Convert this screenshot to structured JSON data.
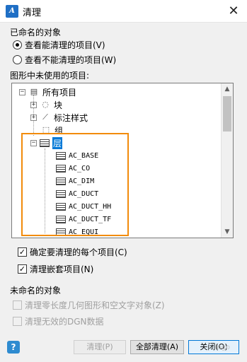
{
  "window": {
    "title": "清理",
    "close_glyph": "✕",
    "app_icon_glyph": "A"
  },
  "named_objects": {
    "group_label": "已命名的对象",
    "radio_purgeable": "查看能清理的项目(V)",
    "radio_non_purgeable": "查看不能清理的项目(W)",
    "tree_label": "图形中未使用的项目:"
  },
  "tree": {
    "root": "所有项目",
    "nodes": [
      "块",
      "标注样式",
      "组"
    ],
    "layer_node": "层",
    "layers": [
      "AC_BASE",
      "AC_CO",
      "AC_DIM",
      "AC_DUCT",
      "AC_DUCT_HH",
      "AC_DUCT_TF",
      "AC_EQUI"
    ],
    "expand_minus": "−",
    "expand_plus": "+"
  },
  "options": {
    "confirm_each": "确定要清理的每个项目(C)",
    "purge_nested": "清理嵌套项目(N)"
  },
  "unnamed_objects": {
    "group_label": "未命名的对象",
    "zero_length": "清理零长度几何图形和空文字对象(Z)",
    "invalid_dgn": "清理无效的DGN数据"
  },
  "buttons": {
    "purge": "清理(P)",
    "purge_all": "全部清理(A)",
    "close": "关闭(O)",
    "help": "?"
  },
  "glyphs": {
    "check": "✓",
    "up": "▲",
    "down": "▼"
  },
  "watermark": "logo"
}
